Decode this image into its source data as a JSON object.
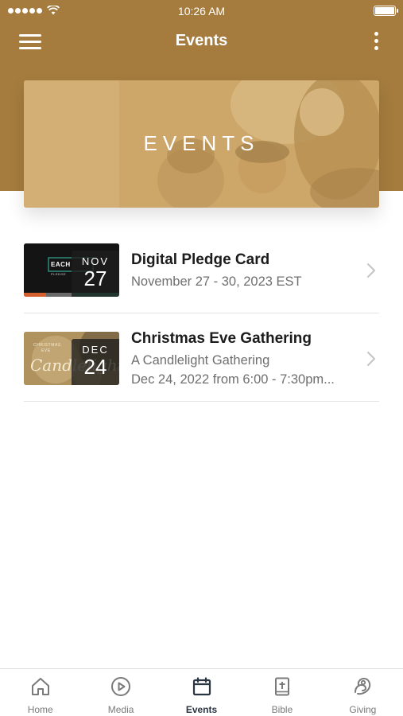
{
  "status_bar": {
    "time": "10:26 AM"
  },
  "nav": {
    "title": "Events",
    "menu_icon": "hamburger-menu-icon",
    "more_icon": "more-vertical-icon"
  },
  "banner": {
    "title": "EVENTS"
  },
  "events": [
    {
      "title": "Digital Pledge Card",
      "subtitle": "November 27 - 30, 2023 EST",
      "date_month": "NOV",
      "date_day": "27",
      "thumb_text": "EACH",
      "thumb_subtext": "PLEDGE"
    },
    {
      "title": "Christmas Eve Gathering",
      "subtitle": "A Candlelight Gathering",
      "detail": "Dec 24, 2022 from 6:00 - 7:30pm...",
      "date_month": "DEC",
      "date_day": "24",
      "thumb_text": "CHRISTMAS",
      "thumb_subtext": "EVE",
      "thumb_script": "Candlelight"
    }
  ],
  "tabs": [
    {
      "label": "Home",
      "icon": "home-icon",
      "active": false
    },
    {
      "label": "Media",
      "icon": "play-circle-icon",
      "active": false
    },
    {
      "label": "Events",
      "icon": "calendar-icon",
      "active": true
    },
    {
      "label": "Bible",
      "icon": "bible-icon",
      "active": false
    },
    {
      "label": "Giving",
      "icon": "giving-icon",
      "active": false
    }
  ],
  "colors": {
    "header": "#a57c3e",
    "active_tab": "#2b3542",
    "inactive_tab": "#7a7a7a"
  }
}
